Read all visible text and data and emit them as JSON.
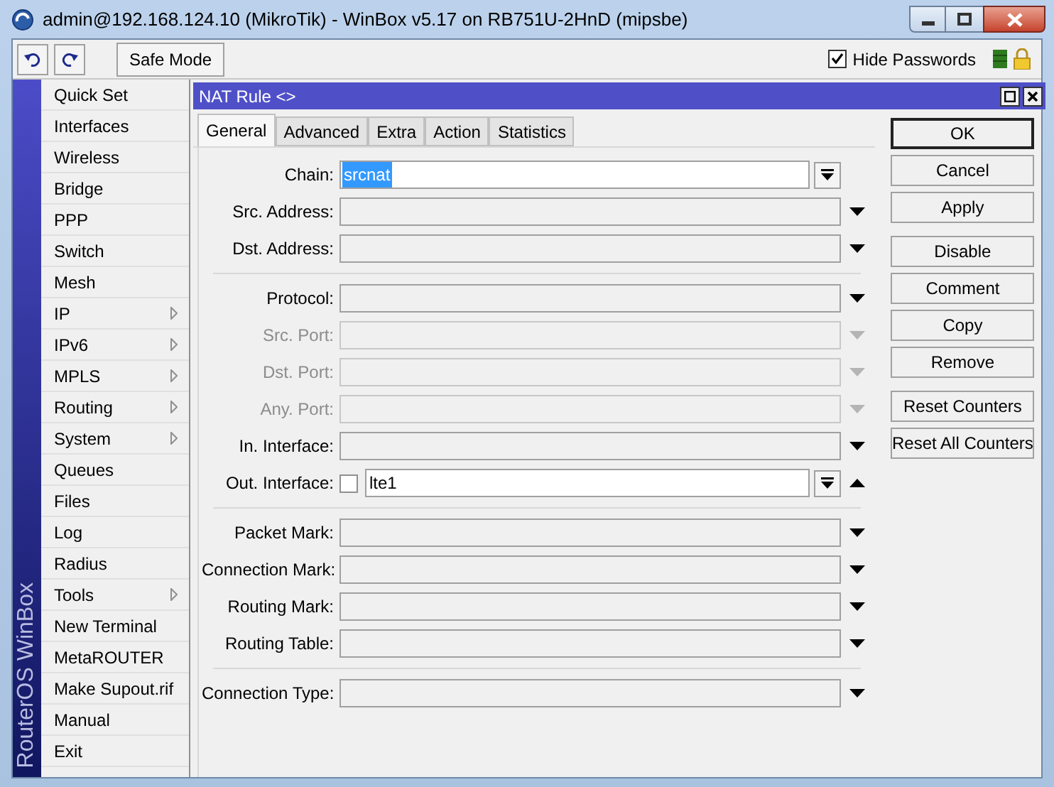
{
  "window": {
    "title": "admin@192.168.124.10 (MikroTik) - WinBox v5.17 on RB751U-2HnD (mipsbe)"
  },
  "toolbar": {
    "safe_mode": "Safe Mode",
    "hide_passwords": {
      "label": "Hide Passwords",
      "checked": true
    }
  },
  "sidebar": {
    "brand": "RouterOS WinBox",
    "items": [
      {
        "label": "Quick Set",
        "submenu": false
      },
      {
        "label": "Interfaces",
        "submenu": false
      },
      {
        "label": "Wireless",
        "submenu": false
      },
      {
        "label": "Bridge",
        "submenu": false
      },
      {
        "label": "PPP",
        "submenu": false
      },
      {
        "label": "Switch",
        "submenu": false
      },
      {
        "label": "Mesh",
        "submenu": false
      },
      {
        "label": "IP",
        "submenu": true
      },
      {
        "label": "IPv6",
        "submenu": true
      },
      {
        "label": "MPLS",
        "submenu": true
      },
      {
        "label": "Routing",
        "submenu": true
      },
      {
        "label": "System",
        "submenu": true
      },
      {
        "label": "Queues",
        "submenu": false
      },
      {
        "label": "Files",
        "submenu": false
      },
      {
        "label": "Log",
        "submenu": false
      },
      {
        "label": "Radius",
        "submenu": false
      },
      {
        "label": "Tools",
        "submenu": true
      },
      {
        "label": "New Terminal",
        "submenu": false
      },
      {
        "label": "MetaROUTER",
        "submenu": false
      },
      {
        "label": "Make Supout.rif",
        "submenu": false
      },
      {
        "label": "Manual",
        "submenu": false
      },
      {
        "label": "Exit",
        "submenu": false
      }
    ]
  },
  "dialog": {
    "title": "NAT Rule <>",
    "tabs": [
      {
        "label": "General",
        "selected": true
      },
      {
        "label": "Advanced",
        "selected": false
      },
      {
        "label": "Extra",
        "selected": false
      },
      {
        "label": "Action",
        "selected": false
      },
      {
        "label": "Statistics",
        "selected": false
      }
    ],
    "groups": [
      [
        {
          "label": "Chain:",
          "kind": "combo",
          "value": "srcnat",
          "disabled": false
        },
        {
          "label": "Src. Address:",
          "kind": "text",
          "disabled": false,
          "expanded": false
        },
        {
          "label": "Dst. Address:",
          "kind": "text",
          "disabled": false,
          "expanded": false
        }
      ],
      [
        {
          "label": "Protocol:",
          "kind": "text",
          "disabled": false,
          "expanded": false
        },
        {
          "label": "Src. Port:",
          "kind": "text",
          "disabled": true,
          "expanded": false
        },
        {
          "label": "Dst. Port:",
          "kind": "text",
          "disabled": true,
          "expanded": false
        },
        {
          "label": "Any. Port:",
          "kind": "text",
          "disabled": true,
          "expanded": false
        },
        {
          "label": "In. Interface:",
          "kind": "text",
          "disabled": false,
          "expanded": false
        },
        {
          "label": "Out. Interface:",
          "kind": "combo",
          "value": "lte1",
          "disabled": false,
          "negate": false,
          "expanded": true
        }
      ],
      [
        {
          "label": "Packet Mark:",
          "kind": "text",
          "disabled": false,
          "expanded": false
        },
        {
          "label": "Connection Mark:",
          "kind": "text",
          "disabled": false,
          "expanded": false
        },
        {
          "label": "Routing Mark:",
          "kind": "text",
          "disabled": false,
          "expanded": false
        },
        {
          "label": "Routing Table:",
          "kind": "text",
          "disabled": false,
          "expanded": false
        }
      ],
      [
        {
          "label": "Connection Type:",
          "kind": "text",
          "disabled": false,
          "expanded": false
        }
      ]
    ],
    "buttons": [
      [
        {
          "label": "OK",
          "default": true
        },
        {
          "label": "Cancel",
          "default": false
        },
        {
          "label": "Apply",
          "default": false
        }
      ],
      [
        {
          "label": "Disable",
          "default": false
        },
        {
          "label": "Comment",
          "default": false
        },
        {
          "label": "Copy",
          "default": false
        },
        {
          "label": "Remove",
          "default": false
        }
      ],
      [
        {
          "label": "Reset Counters",
          "default": false
        },
        {
          "label": "Reset All Counters",
          "default": false
        }
      ]
    ]
  }
}
